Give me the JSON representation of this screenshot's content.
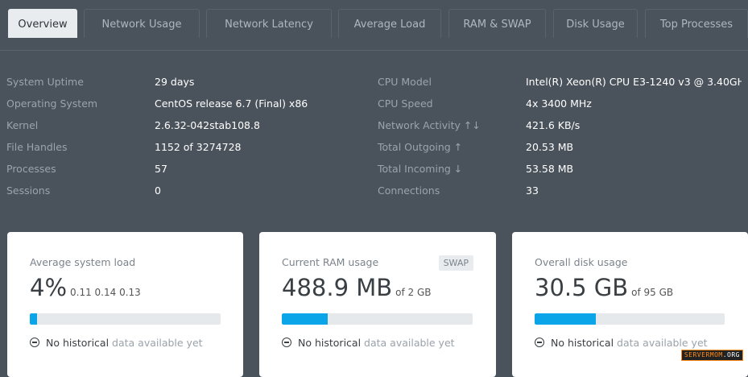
{
  "tabs": [
    {
      "label": "Overview",
      "active": true
    },
    {
      "label": "Network Usage"
    },
    {
      "label": "Network Latency"
    },
    {
      "label": "Average Load"
    },
    {
      "label": "RAM & SWAP"
    },
    {
      "label": "Disk Usage"
    },
    {
      "label": "Top Processes"
    }
  ],
  "info_left": [
    {
      "label": "System Uptime",
      "value": "29 days"
    },
    {
      "label": "Operating System",
      "value": "CentOS release 6.7 (Final) x86"
    },
    {
      "label": "Kernel",
      "value": "2.6.32-042stab108.8"
    },
    {
      "label": "File Handles",
      "value": "1152 of 3274728"
    },
    {
      "label": "Processes",
      "value": "57"
    },
    {
      "label": "Sessions",
      "value": "0"
    }
  ],
  "info_right": [
    {
      "label": "CPU Model",
      "value": "Intel(R) Xeon(R) CPU E3-1240 v3 @ 3.40GH..."
    },
    {
      "label": "CPU Speed",
      "value": "4x 3400 MHz"
    },
    {
      "label": "Network Activity ↑↓",
      "value": "421.6 KB/s"
    },
    {
      "label": "Total Outgoing ↑",
      "value": "20.53 MB"
    },
    {
      "label": "Total Incoming ↓",
      "value": "53.58 MB"
    },
    {
      "label": "Connections",
      "value": "33"
    }
  ],
  "cards": {
    "load": {
      "title": "Average system load",
      "value": "4%",
      "sub": "0.11 0.14 0.13",
      "fill": 0.04,
      "note_strong": "No historical",
      "note_muted": "data available yet"
    },
    "ram": {
      "title": "Current RAM usage",
      "badge": "SWAP",
      "value": "488.9 MB",
      "sub": "of 2 GB",
      "fill": 0.24,
      "note_strong": "No historical",
      "note_muted": "data available yet"
    },
    "disk": {
      "title": "Overall disk usage",
      "value": "30.5 GB",
      "sub": "of 95 GB",
      "fill": 0.32,
      "note_strong": "No historical",
      "note_muted": "data available yet"
    }
  },
  "watermark": {
    "part1": "SERVERMOM",
    "part2": "ORG"
  },
  "colors": {
    "background": "#4a525b",
    "accent": "#0aa5e8",
    "card": "#ffffff"
  }
}
